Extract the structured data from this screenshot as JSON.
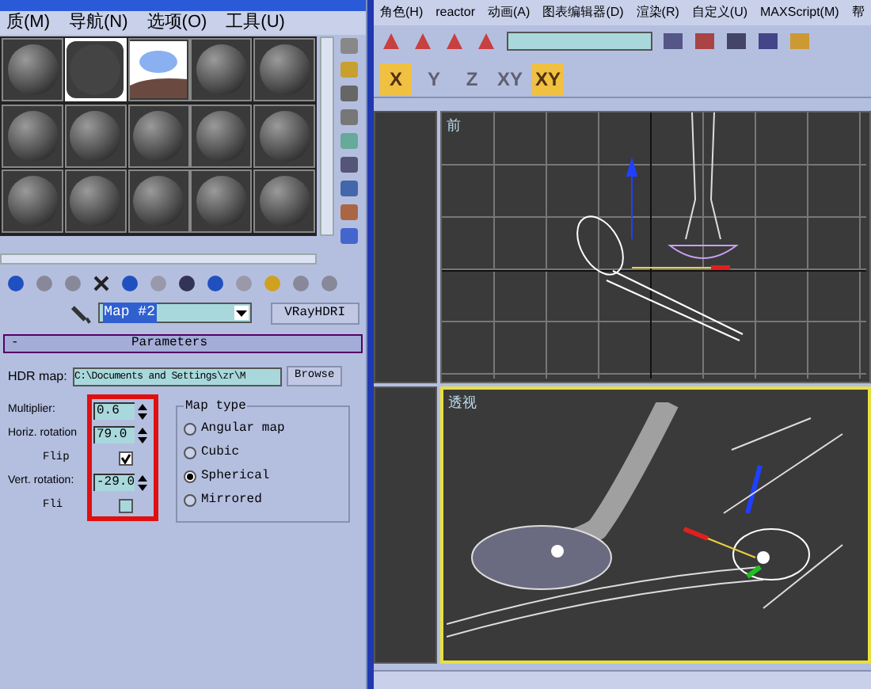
{
  "material_editor": {
    "menu": [
      "质(M)",
      "导航(N)",
      "选项(O)",
      "工具(U)"
    ],
    "slots": [
      {
        "kind": "sphere",
        "selected": false
      },
      {
        "kind": "dark",
        "selected": true
      },
      {
        "kind": "hdri",
        "selected": false
      },
      {
        "kind": "sphere",
        "selected": false
      },
      {
        "kind": "sphere",
        "selected": false
      },
      {
        "kind": "sphere",
        "selected": false
      },
      {
        "kind": "sphere",
        "selected": false
      },
      {
        "kind": "sphere",
        "selected": false
      },
      {
        "kind": "sphere",
        "selected": false
      },
      {
        "kind": "sphere",
        "selected": false
      },
      {
        "kind": "sphere",
        "selected": false
      },
      {
        "kind": "sphere",
        "selected": false
      },
      {
        "kind": "sphere",
        "selected": false
      },
      {
        "kind": "sphere",
        "selected": false
      },
      {
        "kind": "sphere",
        "selected": false
      }
    ],
    "map_name": "Map #2",
    "map_type_button": "VRayHDRI",
    "parameters": {
      "collapse": "-",
      "title": "Parameters",
      "hdr_label": "HDR map:",
      "hdr_path": "C:\\Documents and Settings\\zr\\M",
      "browse": "Browse",
      "spinners": [
        {
          "label": "Multiplier:",
          "value": "0.6"
        },
        {
          "label": "Horiz. rotation",
          "value": "79.0"
        },
        {
          "label": "Vert. rotation:",
          "value": "-29.0"
        }
      ],
      "flips": [
        {
          "label": "Flip",
          "checked": true
        },
        {
          "label": "Fli",
          "checked": false
        }
      ],
      "map_type": {
        "title": "Map type",
        "options": [
          {
            "label": "Angular map",
            "selected": false
          },
          {
            "label": "Cubic",
            "selected": false
          },
          {
            "label": "Spherical",
            "selected": true
          },
          {
            "label": "Mirrored",
            "selected": false
          }
        ]
      }
    }
  },
  "main": {
    "menu": [
      "角色(H)",
      "reactor",
      "动画(A)",
      "图表编辑器(D)",
      "渲染(R)",
      "自定义(U)",
      "MAXScript(M)",
      "帮"
    ],
    "axes": [
      {
        "label": "X",
        "selected": true
      },
      {
        "label": "Y",
        "selected": false
      },
      {
        "label": "Z",
        "selected": false
      },
      {
        "label": "XY",
        "selected": false
      },
      {
        "label": "XY",
        "selected": true
      }
    ],
    "viewports": [
      {
        "label": "前",
        "active": false
      },
      {
        "label": "透视",
        "active": true
      }
    ]
  }
}
